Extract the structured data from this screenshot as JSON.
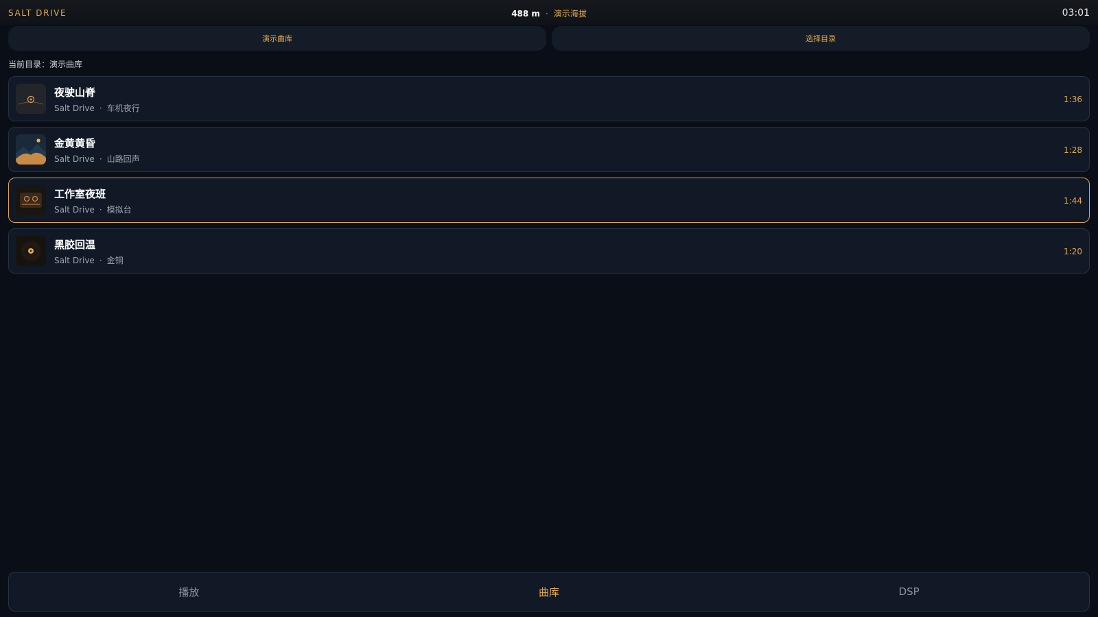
{
  "app": {
    "brand": "SALT DRIVE",
    "clock": "03:01"
  },
  "status": {
    "altitude": "488 m",
    "separator": "·",
    "altitude_label": "演示海拔"
  },
  "top_buttons": {
    "demo_library": "演示曲库",
    "choose_directory": "选择目录"
  },
  "current_dir": "当前目录：演示曲库",
  "tracks": [
    {
      "title": "夜驶山脊",
      "artist": "Salt Drive",
      "dot": "·",
      "album": "车机夜行",
      "duration": "1:36",
      "cover_icon": "ridge-cover-icon"
    },
    {
      "title": "金黄黄昏",
      "artist": "Salt Drive",
      "dot": "·",
      "album": "山路回声",
      "duration": "1:28",
      "cover_icon": "mountain-cover-icon"
    },
    {
      "title": "工作室夜班",
      "artist": "Salt Drive",
      "dot": "·",
      "album": "模拟台",
      "duration": "1:44",
      "cover_icon": "cassette-cover-icon"
    },
    {
      "title": "黑胶回温",
      "artist": "Salt Drive",
      "dot": "·",
      "album": "金铜",
      "duration": "1:20",
      "cover_icon": "vinyl-cover-icon"
    }
  ],
  "nav": {
    "play": "播放",
    "library": "曲库",
    "dsp": "DSP",
    "active": "library"
  },
  "colors": {
    "accent": "#e2a84b",
    "background": "#0a0f17",
    "card": "#111926",
    "card_border": "#283240"
  }
}
